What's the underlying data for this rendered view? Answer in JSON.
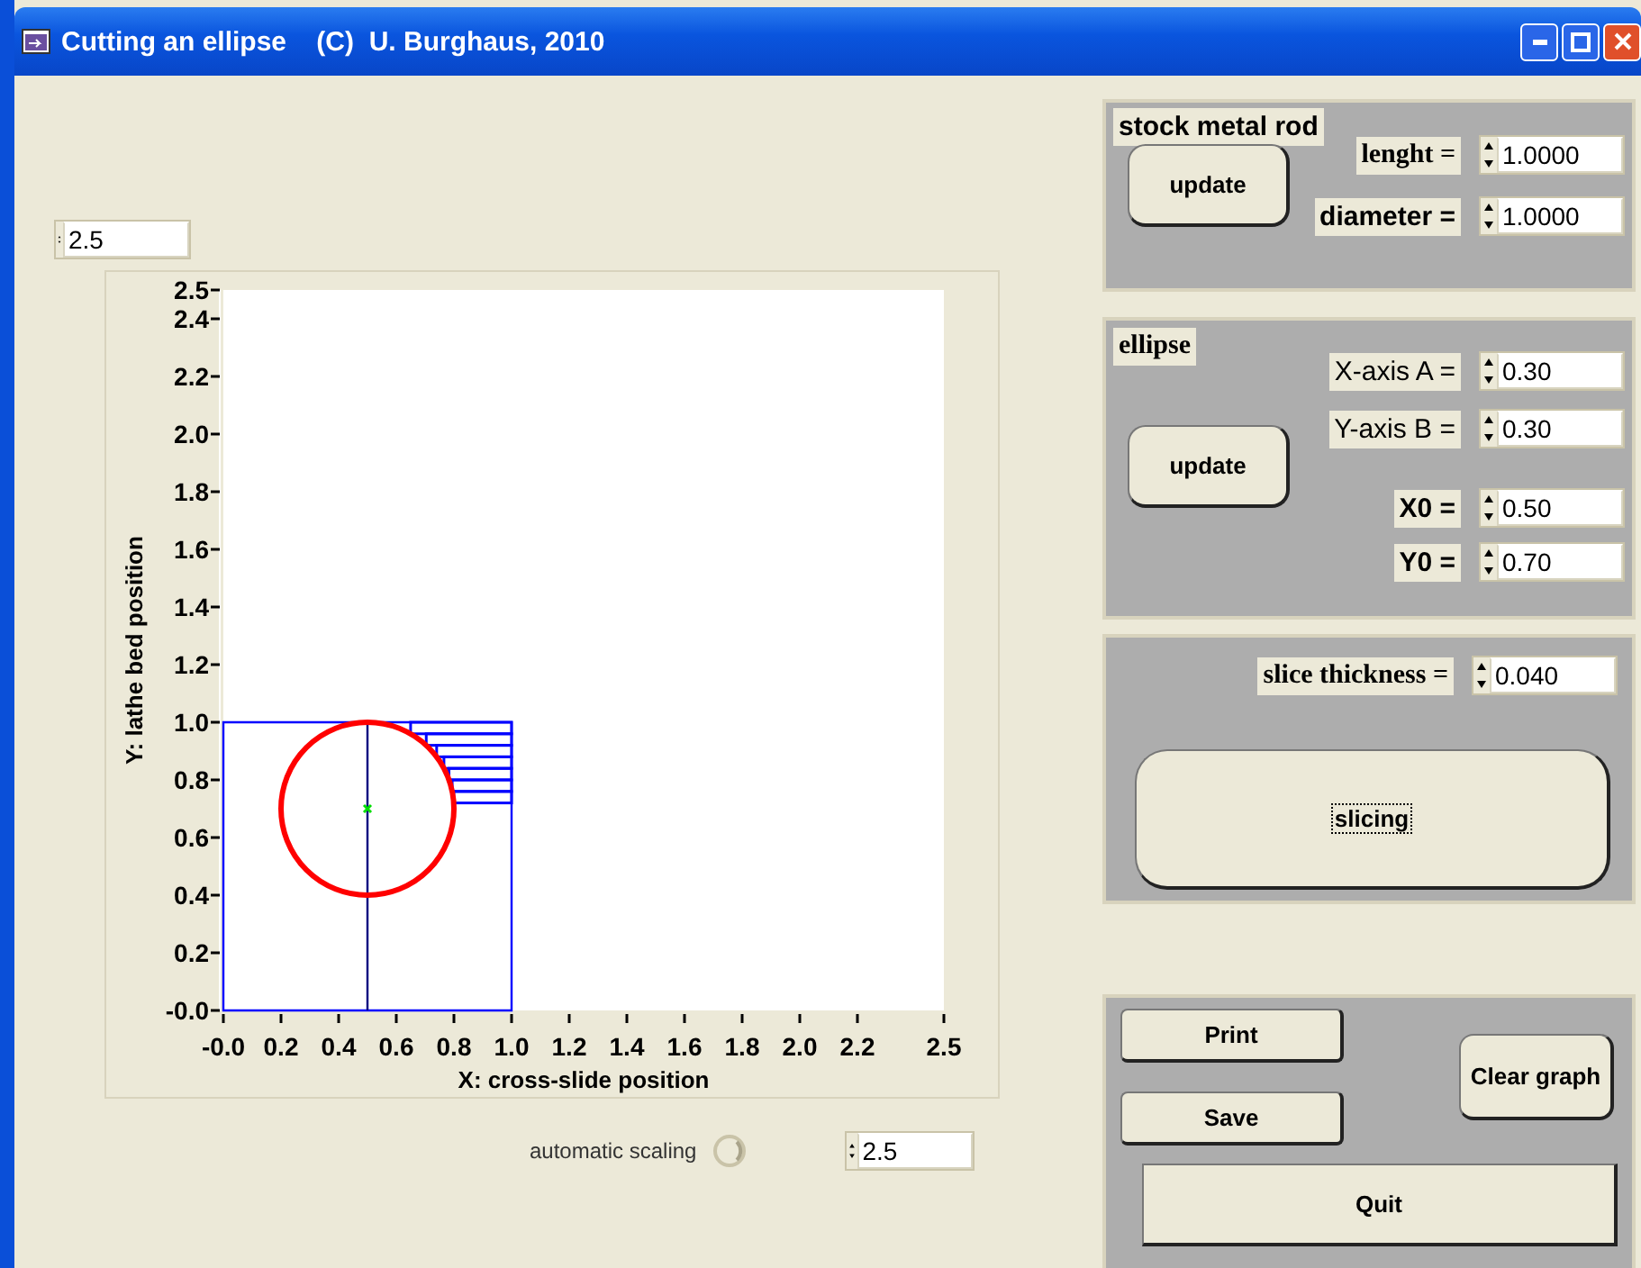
{
  "window": {
    "title": "Cutting an ellipse    (C)  U. Burghaus, 2010"
  },
  "plot": {
    "y_max_field": {
      "value": "2.5"
    },
    "chart_data": {
      "type": "line",
      "xlabel": "X: cross-slide position",
      "ylabel": "Y: lathe bed position",
      "xlim": [
        0,
        2.5
      ],
      "ylim": [
        0,
        2.5
      ],
      "xticks": [
        {
          "value": 0,
          "label": "-0.0"
        },
        {
          "value": 0.2,
          "label": "0.2"
        },
        {
          "value": 0.4,
          "label": "0.4"
        },
        {
          "value": 0.6,
          "label": "0.6"
        },
        {
          "value": 0.8,
          "label": "0.8"
        },
        {
          "value": 1,
          "label": "1.0"
        },
        {
          "value": 1.2,
          "label": "1.2"
        },
        {
          "value": 1.4,
          "label": "1.4"
        },
        {
          "value": 1.6,
          "label": "1.6"
        },
        {
          "value": 1.8,
          "label": "1.8"
        },
        {
          "value": 2,
          "label": "2.0"
        },
        {
          "value": 2.2,
          "label": "2.2"
        },
        {
          "value": 2.5,
          "label": "2.5"
        }
      ],
      "yticks": [
        {
          "value": 0,
          "label": "-0.0"
        },
        {
          "value": 0.2,
          "label": "0.2"
        },
        {
          "value": 0.4,
          "label": "0.4"
        },
        {
          "value": 0.6,
          "label": "0.6"
        },
        {
          "value": 0.8,
          "label": "0.8"
        },
        {
          "value": 1,
          "label": "1.0"
        },
        {
          "value": 1.2,
          "label": "1.2"
        },
        {
          "value": 1.4,
          "label": "1.4"
        },
        {
          "value": 1.6,
          "label": "1.6"
        },
        {
          "value": 1.8,
          "label": "1.8"
        },
        {
          "value": 2,
          "label": "2.0"
        },
        {
          "value": 2.2,
          "label": "2.2"
        },
        {
          "value": 2.4,
          "label": "2.4"
        },
        {
          "value": 2.5,
          "label": "2.5"
        }
      ]
    },
    "automatic_scaling": {
      "label": "automatic scaling"
    },
    "x_max_field": {
      "value": "2.5"
    }
  },
  "stock_rod": {
    "title": "stock metal rod",
    "update_label": "update",
    "fields": [
      {
        "label": "lenght =",
        "value": "1.0000"
      },
      {
        "label": "diameter =",
        "value": "1.0000"
      }
    ]
  },
  "ellipse": {
    "title": "ellipse",
    "update_label": "update",
    "fields": [
      {
        "label": "X-axis A =",
        "value": "0.30"
      },
      {
        "label": "Y-axis B =",
        "value": "0.30"
      },
      {
        "label": "X0 =",
        "value": "0.50"
      },
      {
        "label": "Y0 =",
        "value": "0.70"
      }
    ]
  },
  "slicing": {
    "label": "slice thickness =",
    "value": "0.040",
    "button": {
      "label": "slicing",
      "focused": true
    }
  },
  "buttons": {
    "print": "Print",
    "save": "Save",
    "clear": "Clear graph",
    "quit": "Quit"
  }
}
